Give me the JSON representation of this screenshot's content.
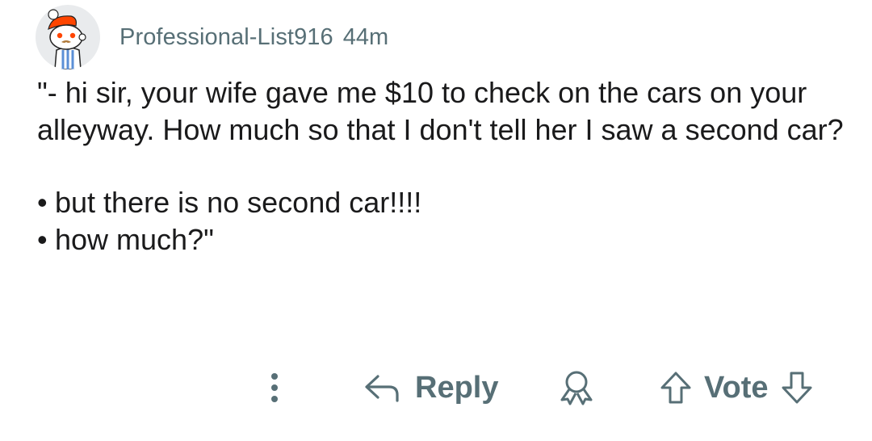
{
  "comment": {
    "username": "Professional-List916",
    "age": "44m",
    "paragraph1": "\"- hi sir, your wife gave me $10 to check on the cars on your alleyway. How much so that I don't tell her I saw a second car?",
    "bullet_glyph": "•",
    "bullets": [
      "but there is no second car!!!!",
      "how much?\""
    ]
  },
  "actions": {
    "more_icon": "vertical-dots-icon",
    "reply_icon": "reply-arrow-icon",
    "reply_label": "Reply",
    "award_icon": "award-icon",
    "upvote_icon": "upvote-arrow-icon",
    "vote_label": "Vote",
    "downvote_icon": "downvote-arrow-icon"
  },
  "colors": {
    "text": "#1a1a1b",
    "meta": "#576f76",
    "avatar_bg": "#e9ebed",
    "avatar_accent": "#ff4500"
  }
}
